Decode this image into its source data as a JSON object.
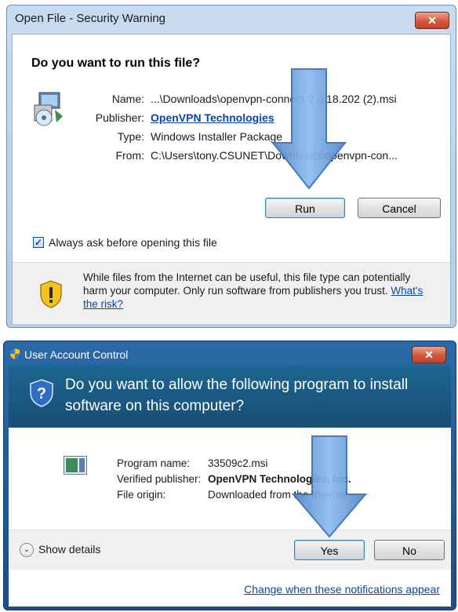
{
  "security_warning": {
    "title": "Open File - Security Warning",
    "close": "✕",
    "question": "Do you want to run this file?",
    "labels": {
      "name": "Name:",
      "publisher": "Publisher:",
      "type": "Type:",
      "from": "From:"
    },
    "values": {
      "name": "...\\Downloads\\openvpn-connect-2.0.18.202 (2).msi",
      "publisher": "OpenVPN Technologies",
      "type": "Windows Installer Package",
      "from": "C:\\Users\\tony.CSUNET\\Downloads\\openvpn-con..."
    },
    "run_label": "Run",
    "cancel_label": "Cancel",
    "always_ask_label": "Always ask before opening this file",
    "always_ask_checked": true,
    "warning_text": "While files from the Internet can be useful, this file type can potentially harm your computer. Only run software from publishers you trust.",
    "risk_link": "What's the risk?"
  },
  "uac": {
    "title": "User Account Control",
    "close": "✕",
    "question": "Do you want to allow the following program to install software on this computer?",
    "labels": {
      "program": "Program name:",
      "publisher": "Verified publisher:",
      "origin": "File origin:"
    },
    "values": {
      "program": "33509c2.msi",
      "publisher": "OpenVPN Technologies, Inc.",
      "origin": "Downloaded from the Internet"
    },
    "show_details": "Show details",
    "yes_label": "Yes",
    "no_label": "No",
    "notifications_link": "Change when these notifications appear"
  },
  "colors": {
    "arrow": "#5b95d9",
    "link": "#0a46a8",
    "uac_header": "#1d6690"
  }
}
